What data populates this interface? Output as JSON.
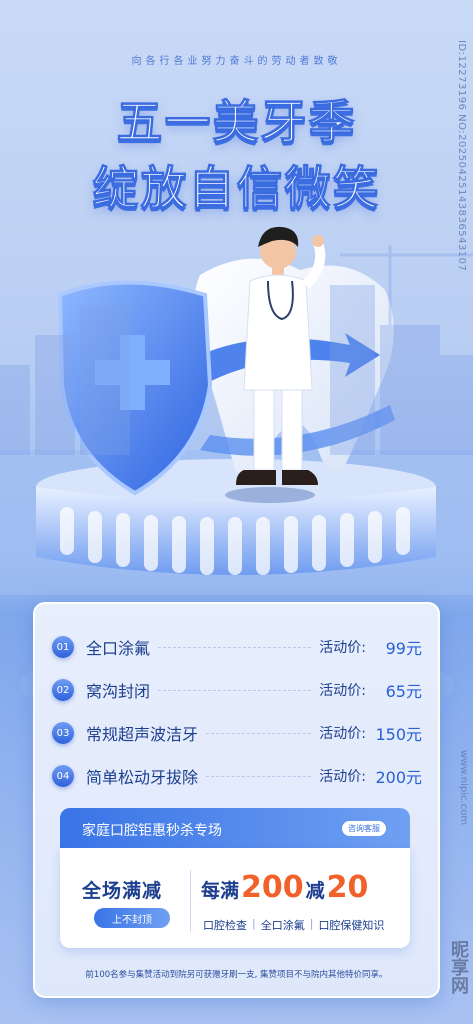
{
  "header": {
    "tagline": "向各行各业努力奋斗的劳动者致敬",
    "title_line1": "五一美牙季",
    "title_line2": "绽放自信微笑"
  },
  "side_id": "ID:12273196 NO:20250425143836543107",
  "services": [
    {
      "num": "01",
      "name": "全口涂氟",
      "price_label": "活动价:",
      "price": "99元"
    },
    {
      "num": "02",
      "name": "窝沟封闭",
      "price_label": "活动价:",
      "price": "65元"
    },
    {
      "num": "03",
      "name": "常规超声波洁牙",
      "price_label": "活动价:",
      "price": "150元"
    },
    {
      "num": "04",
      "name": "简单松动牙拔除",
      "price_label": "活动价:",
      "price": "200元"
    }
  ],
  "promo": {
    "title": "家庭口腔钜惠秒杀专场",
    "consult": "咨询客服",
    "full_reduce": "全场满减",
    "no_cap": "上不封顶",
    "deal_prefix": "每满",
    "deal_threshold": "200",
    "deal_mid": "减",
    "deal_discount": "20",
    "deal_items": [
      "口腔检查",
      "全口涂氟",
      "口腔保健知识"
    ]
  },
  "footer": "前100名参与集赞活动到院另可获赠牙刷一支, 集赞项目不与院内其他特价同享。",
  "watermark": {
    "url": "www.nipic.com",
    "brand": "昵享网"
  },
  "colors": {
    "accent": "#2f62dc",
    "price_highlight": "#f0612c",
    "text_dark": "#1d3f8f"
  }
}
